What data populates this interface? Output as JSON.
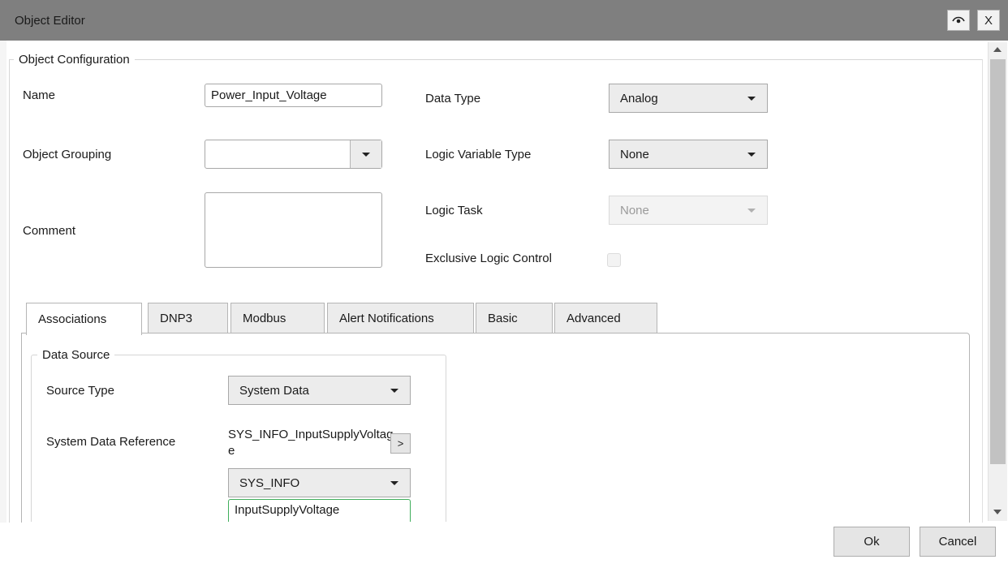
{
  "window": {
    "title": "Object Editor",
    "close_label": "X"
  },
  "config": {
    "legend": "Object Configuration",
    "name_label": "Name",
    "name_value": "Power_Input_Voltage",
    "grouping_label": "Object Grouping",
    "grouping_value": "",
    "comment_label": "Comment",
    "comment_value": "",
    "data_type_label": "Data Type",
    "data_type_value": "Analog",
    "logic_var_label": "Logic Variable Type",
    "logic_var_value": "None",
    "logic_task_label": "Logic Task",
    "logic_task_value": "None",
    "exclusive_label": "Exclusive Logic Control"
  },
  "tabs": [
    {
      "label": "Associations"
    },
    {
      "label": "DNP3"
    },
    {
      "label": "Modbus"
    },
    {
      "label": "Alert Notifications"
    },
    {
      "label": "Basic"
    },
    {
      "label": "Advanced"
    }
  ],
  "data_source": {
    "legend": "Data Source",
    "source_type_label": "Source Type",
    "source_type_value": "System Data",
    "ref_label": "System Data Reference",
    "ref_value_line1": "SYS_INFO_InputSupplyVoltag",
    "ref_value_line2": "e",
    "ref_button": ">",
    "group_value": "SYS_INFO",
    "item_value": "InputSupplyVoltage"
  },
  "footer": {
    "ok": "Ok",
    "cancel": "Cancel"
  }
}
